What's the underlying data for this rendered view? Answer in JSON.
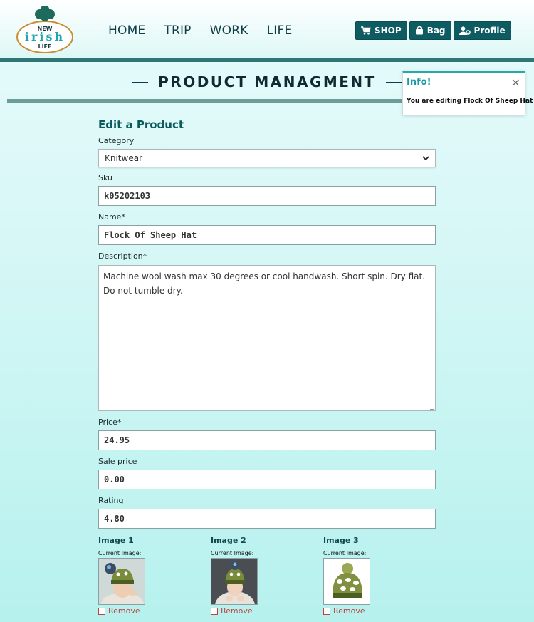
{
  "logo": {
    "top": "NEW",
    "middle": "irish",
    "bottom": "LIFE"
  },
  "nav": [
    "HOME",
    "TRIP",
    "WORK",
    "LIFE"
  ],
  "header_buttons": [
    {
      "label": "SHOP",
      "icon": "cart-icon"
    },
    {
      "label": "Bag",
      "icon": "bag-icon"
    },
    {
      "label": "Profile",
      "icon": "user-gear-icon"
    }
  ],
  "page_title": "PRODUCT MANAGMENT",
  "toast": {
    "title": "Info!",
    "message": "You are editing Flock Of Sheep Hat"
  },
  "form": {
    "heading": "Edit a Product",
    "category": {
      "label": "Category",
      "value": "Knitwear"
    },
    "sku": {
      "label": "Sku",
      "value": "k05202103"
    },
    "name": {
      "label": "Name*",
      "value": "Flock Of Sheep Hat"
    },
    "description": {
      "label": "Description*",
      "value": "Machine wool wash max 30 degrees or cool handwash. Short spin. Dry flat. Do not tumble dry."
    },
    "price": {
      "label": "Price*",
      "value": "24.95"
    },
    "sale_price": {
      "label": "Sale price",
      "value": "0.00"
    },
    "rating": {
      "label": "Rating",
      "value": "4.80"
    }
  },
  "images": [
    {
      "title": "Image 1",
      "current_label": "Current Image:",
      "remove_label": "Remove"
    },
    {
      "title": "Image 2",
      "current_label": "Current Image:",
      "remove_label": "Remove"
    },
    {
      "title": "Image 3",
      "current_label": "Current Image:",
      "remove_label": "Remove"
    }
  ],
  "colors": {
    "accent": "#0f5b62",
    "brand_bar": "#2f7776",
    "remove": "#c0413e"
  }
}
